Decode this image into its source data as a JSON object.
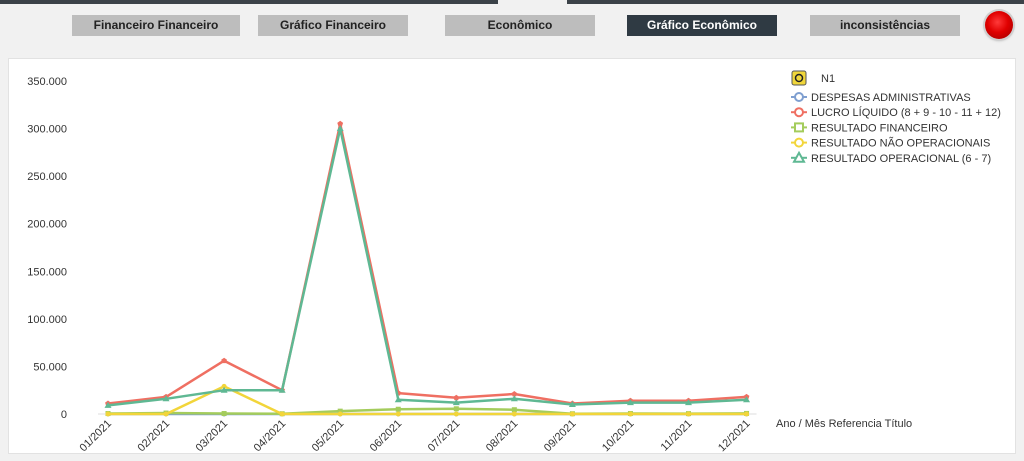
{
  "tabs": [
    {
      "label": "Financeiro Financeiro",
      "active": false
    },
    {
      "label": "Gráfico Financeiro",
      "active": false
    },
    {
      "label": "Econômico",
      "active": false
    },
    {
      "label": "Gráfico Econômico",
      "active": true
    },
    {
      "label": "inconsistências",
      "active": false
    }
  ],
  "status_indicator": {
    "color": "#e00000"
  },
  "chart_data": {
    "type": "line",
    "xlabel": "Ano / Mês Referencia Título",
    "ylabel": "",
    "ylim": [
      0,
      350000
    ],
    "yticks": [
      0,
      50000,
      100000,
      150000,
      200000,
      250000,
      300000,
      350000
    ],
    "ytick_labels": [
      "0",
      "50.000",
      "100.000",
      "150.000",
      "200.000",
      "250.000",
      "300.000",
      "350.000"
    ],
    "legend_title": "N1",
    "legend_position": "top-right",
    "grid": false,
    "categories": [
      "01/2021",
      "02/2021",
      "03/2021",
      "04/2021",
      "05/2021",
      "06/2021",
      "07/2021",
      "08/2021",
      "09/2021",
      "10/2021",
      "11/2021",
      "12/2021"
    ],
    "series": [
      {
        "name": "DESPESAS ADMINISTRATIVAS",
        "color": "#7f9fd0",
        "marker": "circle",
        "values": [
          0,
          0,
          0,
          0,
          0,
          0,
          0,
          0,
          0,
          0,
          0,
          0
        ]
      },
      {
        "name": "LUCRO LÍQUIDO (8 + 9 - 10 - 11 + 12)",
        "color": "#ef6f62",
        "marker": "pentagon",
        "values": [
          11000,
          18000,
          56000,
          25000,
          305000,
          22000,
          17000,
          21000,
          11000,
          14000,
          14000,
          18000
        ]
      },
      {
        "name": "RESULTADO FINANCEIRO",
        "color": "#a4cc5c",
        "marker": "square",
        "values": [
          500,
          1000,
          500,
          300,
          3000,
          5000,
          5500,
          4500,
          300,
          500,
          400,
          600
        ]
      },
      {
        "name": "RESULTADO NÃO OPERACIONAIS",
        "color": "#f2d53a",
        "marker": "circle",
        "values": [
          0,
          0,
          29000,
          0,
          0,
          0,
          0,
          0,
          0,
          0,
          0,
          0
        ]
      },
      {
        "name": "RESULTADO OPERACIONAL (6 - 7)",
        "color": "#5fb893",
        "marker": "triangle",
        "values": [
          9000,
          16000,
          25000,
          25000,
          300000,
          15000,
          12000,
          16000,
          10000,
          12000,
          12000,
          15000
        ]
      }
    ]
  }
}
